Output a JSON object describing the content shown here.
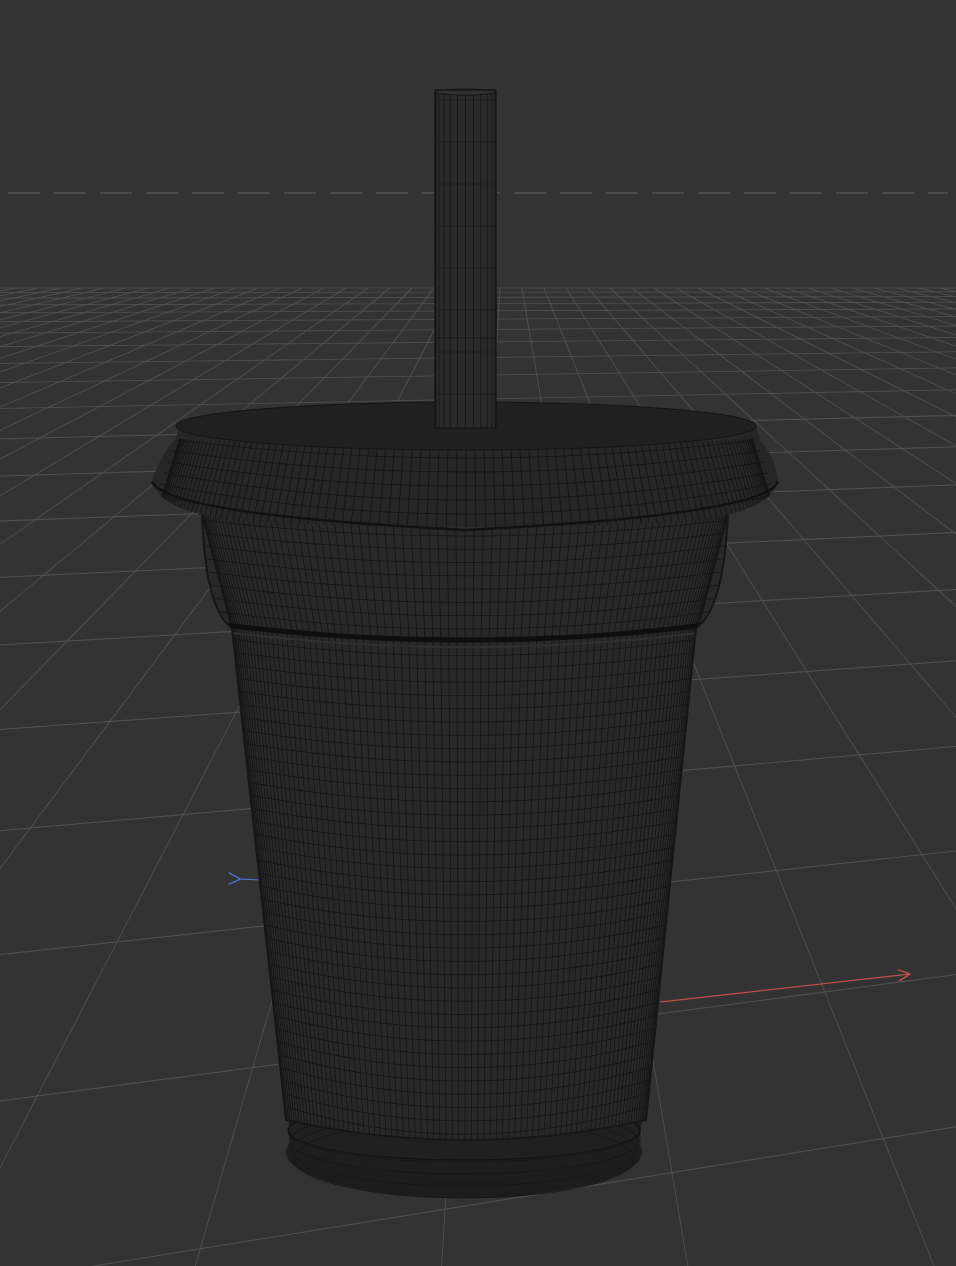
{
  "viewport": {
    "background": "#333333",
    "grid_color": "#555555",
    "grid_color_major": "#5e5e5e",
    "horizon_color": "#585858",
    "x_axis_color": "#c0504d",
    "z_axis_color": "#4a72c8",
    "horizon_dashed": true
  },
  "model": {
    "type": "cup-with-lid-and-straw",
    "display_mode": "wireframe",
    "mesh_color": "#242424",
    "wire_color": "#101010",
    "parts": [
      "straw",
      "lid",
      "cup-body",
      "cup-base"
    ]
  }
}
